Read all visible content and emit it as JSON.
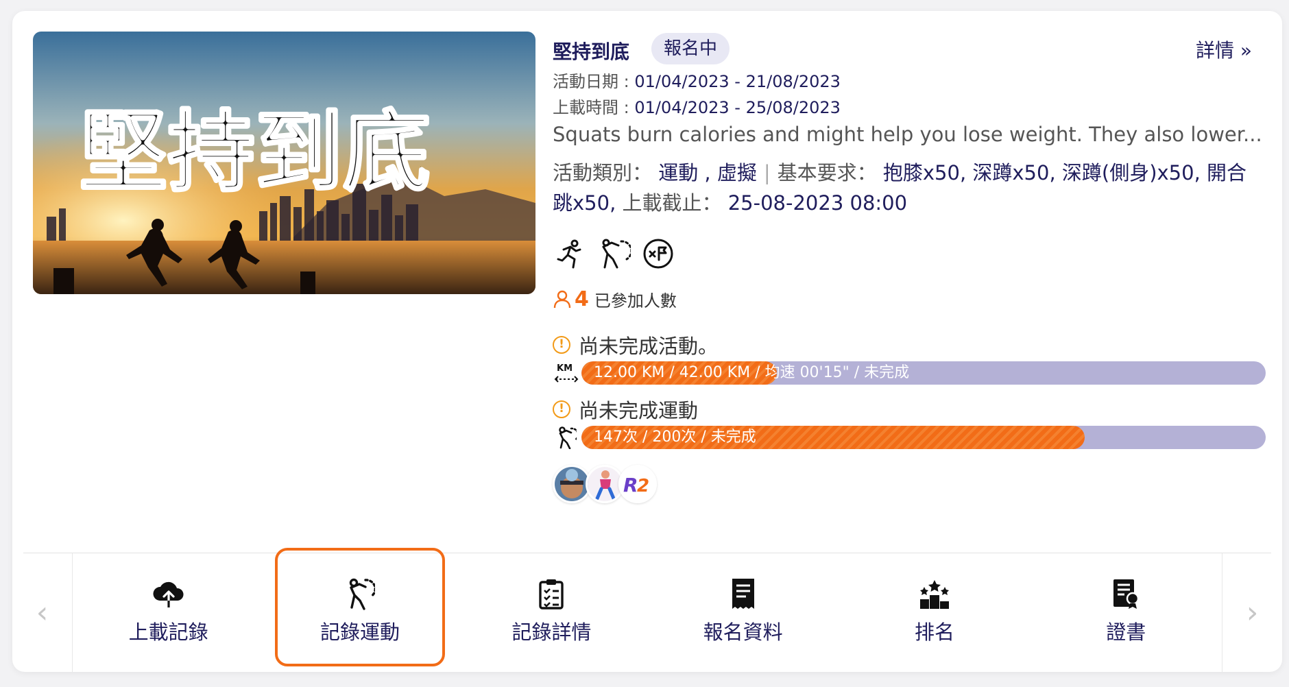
{
  "event": {
    "banner_title": "堅持到底",
    "title": "堅持到底",
    "badge": "報名中",
    "details_link": "詳情 »",
    "activity_date_label": "活動日期 : ",
    "activity_date_value": "01/04/2023 - 21/08/2023",
    "upload_time_label": "上載時間 : ",
    "upload_time_value": "01/04/2023 - 25/08/2023",
    "description": "Squats burn calories and might help you lose weight. They also lower...",
    "category_label": "活動類別： ",
    "category_value": "運動 , 虛擬",
    "requirement_label": "基本要求： ",
    "requirement_value": "抱膝x50, 深蹲x50, 深蹲(側身)x50, 開合跳x50,",
    "deadline_label": " 上載截止： ",
    "deadline_value": "25-08-2023 08:00"
  },
  "activity_icons": [
    "running-icon",
    "stretch-exercise-icon",
    "x-flag-icon"
  ],
  "participants": {
    "count": "4",
    "label": "已參加人數"
  },
  "progress": [
    {
      "status": "尚未完成活動。",
      "unit_icon": "km-distance-icon",
      "text": "12.00 KM / 42.00 KM / 均速 00'15\" / 未完成",
      "fraction": 0.2857
    },
    {
      "status": "尚未完成運動",
      "unit_icon": "exercise-icon",
      "text": "147次 / 200次 / 未完成",
      "fraction": 0.735
    }
  ],
  "avatars": [
    "avatar-photo",
    "avatar-runner",
    "avatar-r2-logo"
  ],
  "nav": {
    "tabs": [
      {
        "label": "上載記錄",
        "icon": "cloud-upload-icon",
        "active": false
      },
      {
        "label": "記錄運動",
        "icon": "exercise-record-icon",
        "active": true
      },
      {
        "label": "記錄詳情",
        "icon": "clipboard-list-icon",
        "active": false
      },
      {
        "label": "報名資料",
        "icon": "receipt-icon",
        "active": false
      },
      {
        "label": "排名",
        "icon": "ranking-podium-icon",
        "active": false
      },
      {
        "label": "證書",
        "icon": "certificate-icon",
        "active": false
      }
    ],
    "prev_arrow": "‹",
    "next_arrow": "›"
  },
  "colors": {
    "accent": "#f26c17",
    "text_primary": "#1f1d5c",
    "bar_track": "#b4b1d6",
    "badge_bg": "#e8e8f4"
  }
}
